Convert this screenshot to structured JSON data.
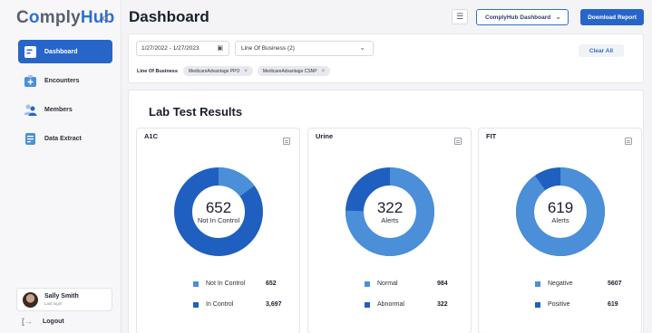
{
  "app": {
    "brand_part1": "C",
    "brand_o": "o",
    "brand_part2": "mply",
    "brand_part3": "Hub",
    "collapse_icon": "«"
  },
  "sidebar": {
    "items": [
      {
        "label": "Dashboard",
        "icon": "dashboard-icon",
        "active": true
      },
      {
        "label": "Encounters",
        "icon": "medical-plus-icon",
        "active": false
      },
      {
        "label": "Members",
        "icon": "members-icon",
        "active": false
      },
      {
        "label": "Data Extract",
        "icon": "document-icon",
        "active": false
      }
    ],
    "user": {
      "name": "Sally Smith",
      "sub": "Last login"
    },
    "logout_label": "Logout"
  },
  "header": {
    "title": "Dashboard",
    "dashboard_select": "ComplyHub Dashboard",
    "download_label": "Download Report"
  },
  "filters": {
    "date_range": "1/27/2022 - 1/27/2023",
    "line_of_business": "Line Of Business (2)",
    "clear_all": "Clear All",
    "chip_label": "Line Of Business",
    "chips": [
      "MedicareAdvantage PPO",
      "MedicareAdvantage CSNP"
    ]
  },
  "section_title": "Lab Test Results",
  "colors": {
    "primary": "#2865c9",
    "donut_dark": "#1f5fbf",
    "donut_light": "#4a8fd8"
  },
  "cards": [
    {
      "title": "A1C",
      "center_value": "652",
      "center_sub": "Not In Control",
      "legend": [
        {
          "name": "Not In Control",
          "value": "652",
          "color": "#4a8fd8"
        },
        {
          "name": "In Control",
          "value": "3,697",
          "color": "#1f5fbf"
        }
      ],
      "share": {
        "light": 0.15,
        "dark": 0.85
      }
    },
    {
      "title": "Urine",
      "center_value": "322",
      "center_sub": "Alerts",
      "legend": [
        {
          "name": "Normal",
          "value": "984",
          "color": "#4a8fd8"
        },
        {
          "name": "Abnormal",
          "value": "322",
          "color": "#1f5fbf"
        }
      ],
      "share": {
        "light": 0.753,
        "dark": 0.247
      }
    },
    {
      "title": "FIT",
      "center_value": "619",
      "center_sub": "Alerts",
      "legend": [
        {
          "name": "Negative",
          "value": "5607",
          "color": "#4a8fd8"
        },
        {
          "name": "Positive",
          "value": "619",
          "color": "#1f5fbf"
        }
      ],
      "share": {
        "light": 0.901,
        "dark": 0.099
      }
    }
  ]
}
